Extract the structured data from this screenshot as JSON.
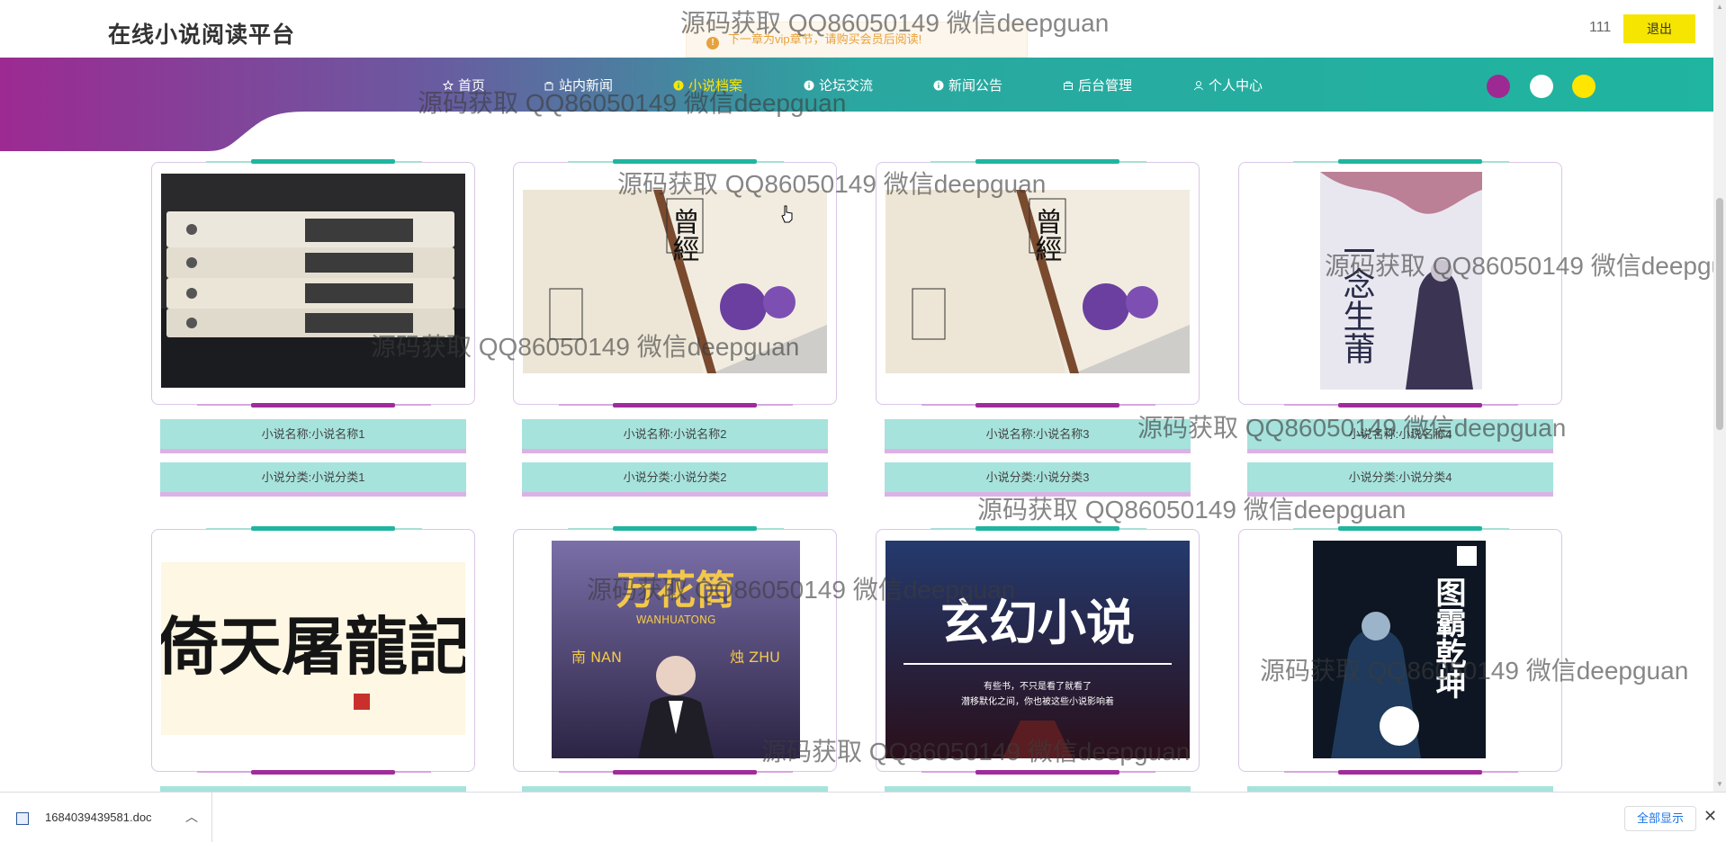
{
  "header": {
    "site_title": "在线小说阅读平台",
    "username": "111",
    "logout_label": "退出"
  },
  "toast": {
    "message": "下一章为vip章节，请购买会员后阅读!"
  },
  "nav": {
    "items": [
      {
        "label": "首页",
        "icon": "star-icon"
      },
      {
        "label": "站内新闻",
        "icon": "bag-icon"
      },
      {
        "label": "小说档案",
        "icon": "info-icon",
        "active": true
      },
      {
        "label": "论坛交流",
        "icon": "info-icon"
      },
      {
        "label": "新闻公告",
        "icon": "info-icon"
      },
      {
        "label": "后台管理",
        "icon": "briefcase-icon"
      },
      {
        "label": "个人中心",
        "icon": "user-icon"
      }
    ],
    "theme_dots": [
      "#9c2a92",
      "#ffffff",
      "#ffe600"
    ]
  },
  "novels": [
    {
      "name": "小说名称:小说名称1",
      "category": "小说分类:小说分类1"
    },
    {
      "name": "小说名称:小说名称2",
      "category": "小说分类:小说分类2"
    },
    {
      "name": "小说名称:小说名称3",
      "category": "小说分类:小说分类3"
    },
    {
      "name": "小说名称:小说名称4",
      "category": "小说分类:小说分类4"
    },
    {
      "name": "",
      "category": "",
      "cover_text": "倚天屠龍記"
    },
    {
      "name": "",
      "category": "",
      "cover_text": "万花筒",
      "cover_sub": "WANHUATONG",
      "cover_sub2": "南 NAN",
      "cover_sub3": "烛 ZHU"
    },
    {
      "name": "",
      "category": "",
      "cover_text": "玄幻小说",
      "cover_sub": "有些书，不只是看了就看了",
      "cover_sub2": "潜移默化之间，你也被这些小说影响着"
    },
    {
      "name": "",
      "category": "",
      "cover_text": "图霸乾坤"
    }
  ],
  "covers": {
    "c2_title": "曾經",
    "c4_title": "一念生莆"
  },
  "watermark": "源码获取 QQ86050149 微信deepguan",
  "download": {
    "filename": "1684039439581.doc",
    "show_all_label": "全部显示"
  },
  "colors": {
    "teal": "#1fb5a0",
    "purple": "#9c2a92",
    "yellow": "#ffe600"
  }
}
